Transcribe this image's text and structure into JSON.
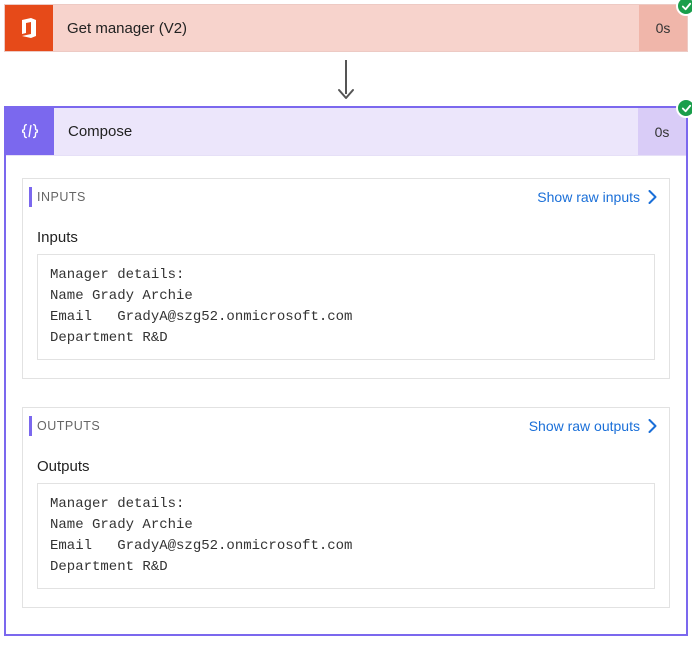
{
  "step1": {
    "title": "Get manager (V2)",
    "time": "0s",
    "icon": "office-icon",
    "status": "success"
  },
  "step2": {
    "title": "Compose",
    "time": "0s",
    "icon": "braces-icon",
    "status": "success",
    "inputs": {
      "section_label": "INPUTS",
      "show_raw_label": "Show raw inputs",
      "subtitle": "Inputs",
      "content": "Manager details:\nName Grady Archie\nEmail   GradyA@szg52.onmicrosoft.com\nDepartment R&D"
    },
    "outputs": {
      "section_label": "OUTPUTS",
      "show_raw_label": "Show raw outputs",
      "subtitle": "Outputs",
      "content": "Manager details:\nName Grady Archie\nEmail   GradyA@szg52.onmicrosoft.com\nDepartment R&D"
    }
  }
}
